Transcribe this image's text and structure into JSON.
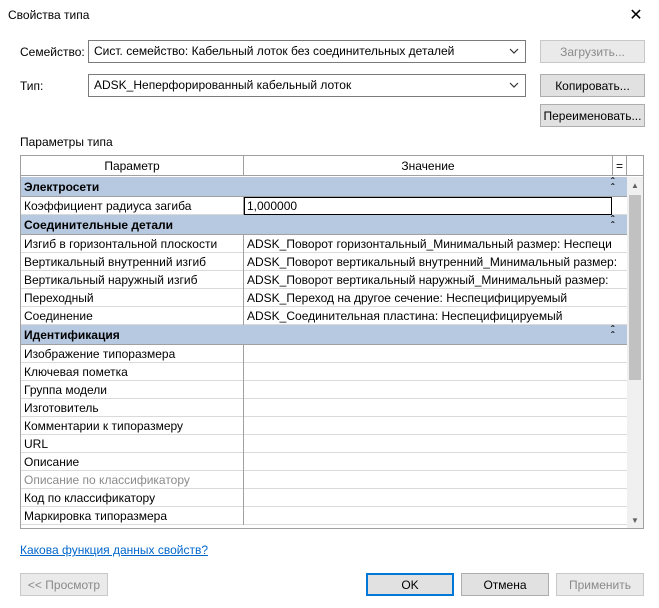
{
  "window": {
    "title": "Свойства типа",
    "close_glyph": "✕"
  },
  "family": {
    "label": "Семейство:",
    "value": "Сист. семейство: Кабельный лоток без соединительных деталей",
    "load_button": "Загрузить..."
  },
  "type": {
    "label": "Тип:",
    "value": "ADSK_Неперфорированный кабельный лоток",
    "copy_button": "Копировать...",
    "rename_button": "Переименовать..."
  },
  "params": {
    "section_label": "Параметры типа",
    "col_param": "Параметр",
    "col_value": "Значение",
    "col_sort": "=",
    "groups": [
      {
        "name": "Электросети",
        "rows": [
          {
            "param": "Коэффициент радиуса загиба",
            "value": "1,000000",
            "editing": true
          }
        ]
      },
      {
        "name": "Соединительные детали",
        "rows": [
          {
            "param": "Изгиб в горизонтальной плоскости",
            "value": "ADSK_Поворот горизонтальный_Минимальный размер: Неспеци"
          },
          {
            "param": "Вертикальный внутренний изгиб",
            "value": "ADSK_Поворот вертикальный внутренний_Минимальный размер:"
          },
          {
            "param": "Вертикальный наружный изгиб",
            "value": "ADSK_Поворот вертикальный наружный_Минимальный размер:"
          },
          {
            "param": "Переходный",
            "value": "ADSK_Переход на другое сечение: Неспецифицируемый"
          },
          {
            "param": "Соединение",
            "value": "ADSK_Соединительная пластина: Неспецифицируемый"
          }
        ]
      },
      {
        "name": "Идентификация",
        "rows": [
          {
            "param": "Изображение типоразмера",
            "value": ""
          },
          {
            "param": "Ключевая пометка",
            "value": ""
          },
          {
            "param": "Группа модели",
            "value": ""
          },
          {
            "param": "Изготовитель",
            "value": ""
          },
          {
            "param": "Комментарии к типоразмеру",
            "value": ""
          },
          {
            "param": "URL",
            "value": ""
          },
          {
            "param": "Описание",
            "value": ""
          },
          {
            "param": "Описание по классификатору",
            "value": "",
            "disabled": true
          },
          {
            "param": "Код по классификатору",
            "value": ""
          },
          {
            "param": "Маркировка типоразмера",
            "value": ""
          }
        ]
      }
    ]
  },
  "help_link": "Какова функция данных свойств?",
  "footer": {
    "preview": "<< Просмотр",
    "ok": "OK",
    "cancel": "Отмена",
    "apply": "Применить"
  },
  "colors": {
    "group_header": "#b7c9e1",
    "link": "#0066cc",
    "default_border": "#0078d7"
  }
}
